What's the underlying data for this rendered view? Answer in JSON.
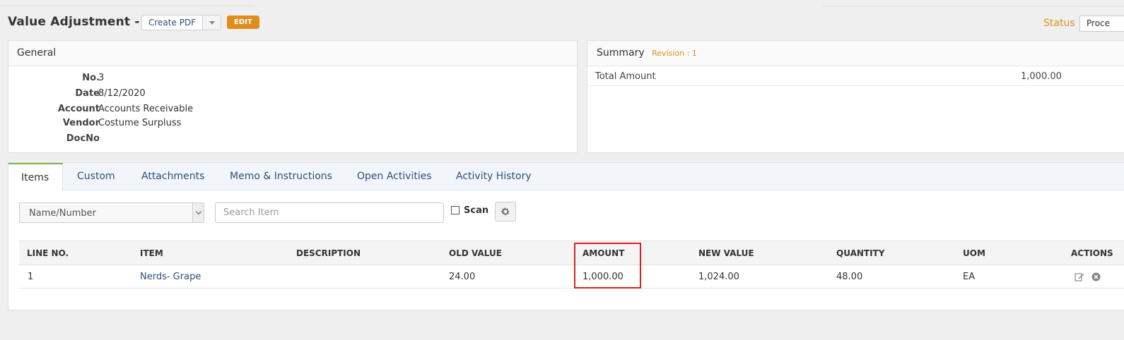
{
  "header": {
    "title": "Value Adjustment - 3",
    "create_pdf_label": "Create PDF",
    "edit_label": "EDIT",
    "status_label": "Status",
    "status_value": "Proce"
  },
  "general": {
    "title": "General",
    "fields": [
      {
        "label": "No.",
        "value": "3"
      },
      {
        "label": "Date",
        "value": "8/12/2020"
      },
      {
        "label": "Account",
        "value": "Accounts Receivable"
      },
      {
        "label": "Vendor",
        "value": "Costume Surpluss"
      },
      {
        "label": "DocNo",
        "value": ""
      }
    ]
  },
  "summary": {
    "title": "Summary",
    "revision": "Revision : 1",
    "total_label": "Total Amount",
    "total_value": "1,000.00"
  },
  "tabs": [
    "Items",
    "Custom",
    "Attachments",
    "Memo & Instructions",
    "Open Activities",
    "Activity History"
  ],
  "toolbar": {
    "search_mode": "Name/Number",
    "search_placeholder": "Search Item",
    "scan_label": "Scan"
  },
  "grid": {
    "columns": [
      "LINE NO.",
      "ITEM",
      "DESCRIPTION",
      "OLD VALUE",
      "AMOUNT",
      "NEW VALUE",
      "QUANTITY",
      "UOM",
      "ACTIONS"
    ],
    "rows": [
      {
        "line_no": "1",
        "item": "Nerds- Grape",
        "description": "",
        "old_value": "24.00",
        "amount": "1,000.00",
        "new_value": "1,024.00",
        "quantity": "48.00",
        "uom": "EA"
      }
    ]
  },
  "colors": {
    "accent_orange": "#e08e1b",
    "link_blue": "#2c4f7c",
    "highlight_red": "#d9231f",
    "tab_active_green": "#7ab648"
  }
}
